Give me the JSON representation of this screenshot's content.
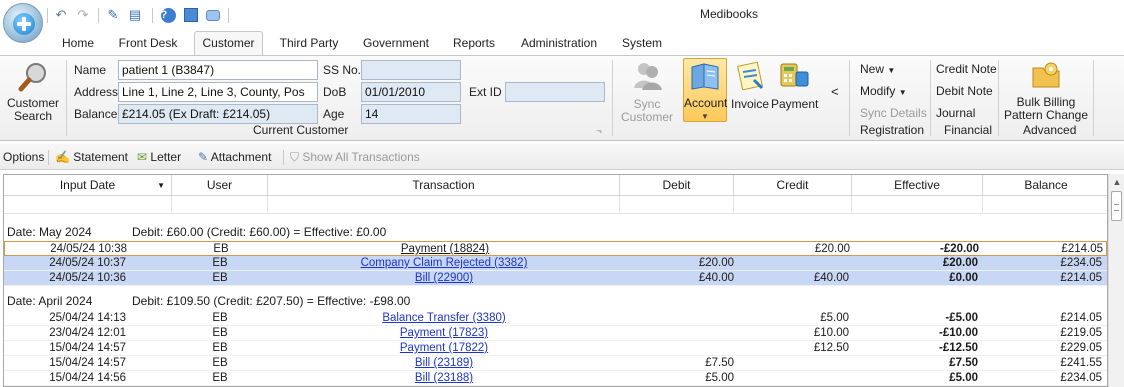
{
  "app": {
    "title": "Medibooks"
  },
  "tabs": [
    "Home",
    "Front Desk",
    "Customer",
    "Third Party",
    "Government",
    "Reports",
    "Administration",
    "System"
  ],
  "active_tab": "Customer",
  "ribbon": {
    "customer_search": "Customer Search",
    "current_customer": {
      "group_label": "Current Customer",
      "name_label": "Name",
      "name_value": "patient 1 (B3847)",
      "address_label": "Address",
      "address_value": "Line 1, Line 2, Line 3, County, Pos",
      "balance_label": "Balance",
      "balance_value": "£214.05 (Ex Draft: £214.05)",
      "ssno_label": "SS No.",
      "ssno_value": "",
      "dob_label": "DoB",
      "dob_value": "01/01/2010",
      "age_label": "Age",
      "age_value": "14",
      "extid_label": "Ext ID",
      "extid_value": ""
    },
    "sync_customer": "Sync Customer",
    "account": "Account",
    "invoice": "Invoice",
    "payment": "Payment",
    "collapse": "<",
    "registration": {
      "new": "New",
      "modify": "Modify",
      "sync_details": "Sync Details",
      "group_label": "Registration"
    },
    "financial": {
      "credit_note": "Credit Note",
      "debit_note": "Debit Note",
      "journal": "Journal",
      "group_label": "Financial"
    },
    "advanced": {
      "bulk_billing": "Bulk Billing Pattern Change",
      "group_label": "Advanced"
    }
  },
  "options_bar": {
    "options": "Options",
    "statement": "Statement",
    "letter": "Letter",
    "attachment": "Attachment",
    "show_all": "Show All Transactions"
  },
  "grid": {
    "columns": [
      "Input Date",
      "User",
      "Transaction",
      "Debit",
      "Credit",
      "Effective",
      "Balance"
    ],
    "groups": [
      {
        "date_label": "Date:  May 2024",
        "summary": "Debit: £60.00 (Credit: £60.00) = Effective: £0.00",
        "rows": [
          {
            "date": "24/05/24 10:38",
            "user": "EB",
            "transaction": "Payment (18824)",
            "debit": "",
            "credit": "£20.00",
            "effective": "-£20.00",
            "balance": "£214.05"
          },
          {
            "date": "24/05/24 10:37",
            "user": "EB",
            "transaction": "Company Claim Rejected (3382)",
            "debit": "£20.00",
            "credit": "",
            "effective": "£20.00",
            "balance": "£234.05"
          },
          {
            "date": "24/05/24 10:36",
            "user": "EB",
            "transaction": "Bill (22900)",
            "debit": "£40.00",
            "credit": "£40.00",
            "effective": "£0.00",
            "balance": "£214.05"
          }
        ]
      },
      {
        "date_label": "Date:  April 2024",
        "summary": "Debit: £109.50 (Credit: £207.50) = Effective: -£98.00",
        "rows": [
          {
            "date": "25/04/24 14:13",
            "user": "EB",
            "transaction": "Balance Transfer (3380)",
            "debit": "",
            "credit": "£5.00",
            "effective": "-£5.00",
            "balance": "£214.05"
          },
          {
            "date": "23/04/24 12:01",
            "user": "EB",
            "transaction": "Payment (17823)",
            "debit": "",
            "credit": "£10.00",
            "effective": "-£10.00",
            "balance": "£219.05"
          },
          {
            "date": "15/04/24 14:57",
            "user": "EB",
            "transaction": "Payment (17822)",
            "debit": "",
            "credit": "£12.50",
            "effective": "-£12.50",
            "balance": "£229.05"
          },
          {
            "date": "15/04/24 14:57",
            "user": "EB",
            "transaction": "Bill (23189)",
            "debit": "£7.50",
            "credit": "",
            "effective": "£7.50",
            "balance": "£241.55"
          },
          {
            "date": "15/04/24 14:56",
            "user": "EB",
            "transaction": "Bill (23188)",
            "debit": "£5.00",
            "credit": "",
            "effective": "£5.00",
            "balance": "£234.05"
          }
        ]
      }
    ]
  },
  "colors": {
    "selection": "#c8d7f3",
    "link": "#1d36c9",
    "focus_border": "#d19a4a",
    "readonly_field": "#dfe9f3"
  }
}
